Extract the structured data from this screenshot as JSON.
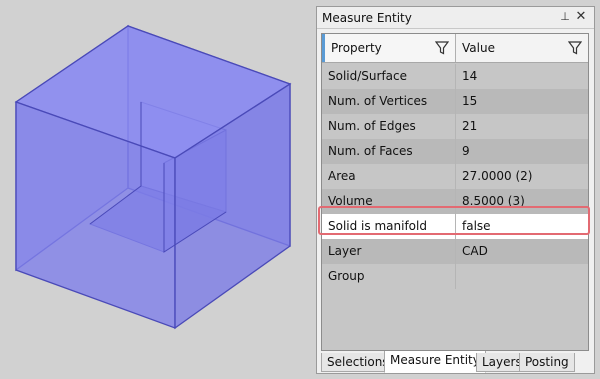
{
  "panel": {
    "title": "Measure Entity",
    "pin_glyph": "⊥",
    "close_glyph": "✕"
  },
  "grid": {
    "columns": [
      "Property",
      "Value"
    ],
    "rows": [
      {
        "property": "Solid/Surface",
        "value": "14"
      },
      {
        "property": "Num. of Vertices",
        "value": "15"
      },
      {
        "property": "Num. of Edges",
        "value": "21"
      },
      {
        "property": "Num. of Faces",
        "value": "9"
      },
      {
        "property": "Area",
        "value": "27.0000 (2)"
      },
      {
        "property": "Volume",
        "value": "8.5000 (3)"
      },
      {
        "property": "Solid is manifold",
        "value": "false"
      },
      {
        "property": "Layer",
        "value": "CAD"
      },
      {
        "property": "Group",
        "value": ""
      }
    ],
    "highlighted_row": "Solid is manifold"
  },
  "tabs": [
    {
      "label": "Selections",
      "active": false
    },
    {
      "label": "Measure Entity",
      "active": true
    },
    {
      "label": "Layers",
      "active": false
    },
    {
      "label": "Posting",
      "active": false
    }
  ],
  "colors": {
    "cube_fill": "#8a8af0",
    "cube_edge": "#4a4ab8",
    "highlight": "#e36a72",
    "viewport_bg": "#d1d1d1"
  },
  "icons": {
    "filter": "filter-icon",
    "pin": "pin-icon",
    "close": "close-icon"
  }
}
